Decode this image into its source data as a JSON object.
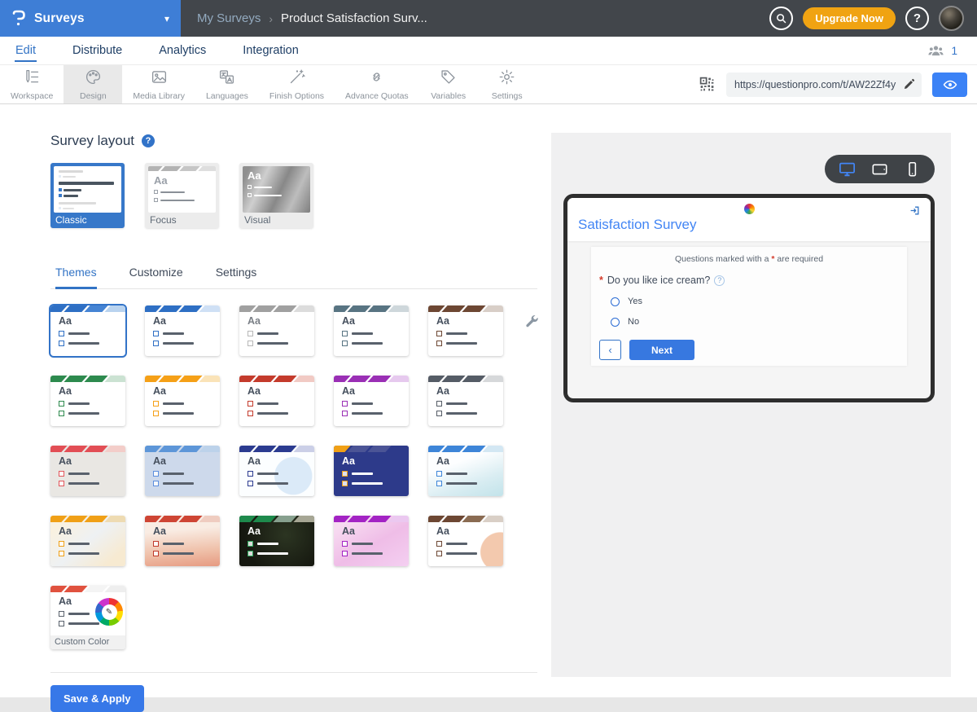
{
  "colors": {
    "accent": "#3273c8",
    "topbar_blue": "#3e7ed6",
    "topbar_dark": "#42464b",
    "upgrade_orange": "#f0a312",
    "preview_title_blue": "#4285f4"
  },
  "topbar": {
    "brand": "Surveys",
    "breadcrumb": {
      "parent": "My Surveys",
      "separator": "›",
      "current": "Product Satisfaction Surv..."
    },
    "upgrade_label": "Upgrade Now",
    "help_label": "?"
  },
  "nav": {
    "items": [
      "Edit",
      "Distribute",
      "Analytics",
      "Integration"
    ],
    "active": "Edit",
    "collaborators_count": "1"
  },
  "toolbar": {
    "items": [
      {
        "label": "Workspace",
        "icon": "workspace-icon"
      },
      {
        "label": "Design",
        "icon": "design-icon"
      },
      {
        "label": "Media Library",
        "icon": "media-library-icon"
      },
      {
        "label": "Languages",
        "icon": "languages-icon"
      },
      {
        "label": "Finish Options",
        "icon": "finish-options-icon"
      },
      {
        "label": "Advance Quotas",
        "icon": "advance-quotas-icon"
      },
      {
        "label": "Variables",
        "icon": "variables-icon"
      },
      {
        "label": "Settings",
        "icon": "settings-icon"
      }
    ],
    "active": "Design",
    "url": "https://questionpro.com/t/AW22Zf4y"
  },
  "survey_layout": {
    "title": "Survey layout",
    "options": [
      {
        "label": "Classic",
        "selected": true
      },
      {
        "label": "Focus",
        "selected": false
      },
      {
        "label": "Visual",
        "selected": false
      }
    ]
  },
  "theme_tabs": {
    "items": [
      "Themes",
      "Customize",
      "Settings"
    ],
    "active": "Themes"
  },
  "sample_text": "Aa",
  "themes": [
    {
      "name": "blue",
      "stripes": [
        "#2e6fc4",
        "#2e6fc4",
        "#4584d4",
        "#b9d3ef"
      ],
      "box": "#2e6fc4",
      "body": "#ffffff",
      "selected": true
    },
    {
      "name": "azure",
      "stripes": [
        "#2e6fc4",
        "#2e6fc4",
        "#2e6fc4",
        "#cfe0f5"
      ],
      "box": "#2e6fc4",
      "body": "#ffffff"
    },
    {
      "name": "gray",
      "stripes": [
        "#a0a0a0",
        "#a0a0a0",
        "#a0a0a0",
        "#dcdcdc"
      ],
      "box": "#b7b7b7",
      "body": "#ffffff",
      "text": "#7a7f86"
    },
    {
      "name": "slate",
      "stripes": [
        "#587482",
        "#587482",
        "#587482",
        "#ced7db"
      ],
      "box": "#587482",
      "body": "#ffffff"
    },
    {
      "name": "brown",
      "stripes": [
        "#6d4733",
        "#6d4733",
        "#6d4733",
        "#d8cec7"
      ],
      "box": "#6d4733",
      "body": "#ffffff"
    },
    {
      "name": "green",
      "stripes": [
        "#2d8a4e",
        "#2d8a4e",
        "#2d8a4e",
        "#cbe2d2"
      ],
      "box": "#2d8a4e",
      "body": "#ffffff"
    },
    {
      "name": "orange",
      "stripes": [
        "#f5a017",
        "#f5a017",
        "#f5a017",
        "#fae3b8"
      ],
      "box": "#f5a017",
      "body": "#ffffff"
    },
    {
      "name": "red",
      "stripes": [
        "#c43b2c",
        "#c43b2c",
        "#c43b2c",
        "#f1cac4"
      ],
      "box": "#c43b2c",
      "body": "#ffffff"
    },
    {
      "name": "purple",
      "stripes": [
        "#9a2fb5",
        "#9a2fb5",
        "#9a2fb5",
        "#e6c9ee"
      ],
      "box": "#9a2fb5",
      "body": "#ffffff"
    },
    {
      "name": "charcoal",
      "stripes": [
        "#555c66",
        "#555c66",
        "#555c66",
        "#d6d8da"
      ],
      "box": "#555c66",
      "body": "#ffffff"
    },
    {
      "name": "crimson-beige",
      "stripes": [
        "#e24e55",
        "#e24e55",
        "#e24e55",
        "#f3cdc9"
      ],
      "box": "#e2565c",
      "body": "#e9e7e3"
    },
    {
      "name": "powder-blue",
      "stripes": [
        "#5d96d8",
        "#5d96d8",
        "#5d96d8",
        "#bcd2ea"
      ],
      "box": "#5c8ede",
      "body": "#cdd9eb"
    },
    {
      "name": "navy-cloud",
      "stripes": [
        "#2b3b90",
        "#2b3b90",
        "#2b3b90",
        "#cbcfe7"
      ],
      "box": "#2b3b90",
      "body": "radial-gradient(circle at 72% 60%, #dbeaf8 30%, #fcfeff 31%)"
    },
    {
      "name": "navy-bold",
      "stripes": [
        "#f0a016",
        "#4b5496",
        "#4b5496",
        "#2d3a8a"
      ],
      "box": "#f0a016",
      "body": "#2d3a8a",
      "text": "#ffffff",
      "lines": "#ffffff"
    },
    {
      "name": "sky",
      "stripes": [
        "#3d85d8",
        "#3d85d8",
        "#3d85d8",
        "#d3e7f3"
      ],
      "box": "#3d85d8",
      "body": "linear-gradient(160deg, #fdfeff 35%, #d9edf2 70%, #c2e3ea 100%)"
    },
    {
      "name": "cream",
      "stripes": [
        "#f0a016",
        "#f0a016",
        "#f0a016",
        "#eedbb2"
      ],
      "box": "#f0a016",
      "body": "linear-gradient(140deg, #f9f1e0 15%, #eef1f3 50%, #f7ead1 85%)"
    },
    {
      "name": "peach",
      "stripes": [
        "#ce4534",
        "#ce4534",
        "#ce4534",
        "#efccc0"
      ],
      "box": "#c0392b",
      "body": "linear-gradient(175deg, #f9ece3 30%, #efc0a9 70%, #e69a81 100%)"
    },
    {
      "name": "forest-dark",
      "stripes": [
        "#1e8a4c",
        "#1e8a4c",
        "#87a08e",
        "#a6a694"
      ],
      "box": "#2fa55c",
      "body": "radial-gradient(circle at 62% 38%, #2c3522 0%, #15170f 75%)",
      "text": "#ffffff",
      "lines": "#ffffff"
    },
    {
      "name": "orchid",
      "stripes": [
        "#a323c4",
        "#a323c4",
        "#a323c4",
        "#ebc8f0"
      ],
      "box": "#a323c4",
      "body": "linear-gradient(150deg, #f7dbf1 15%, #efbde7 55%, #f4cff1 100%)"
    },
    {
      "name": "blush",
      "stripes": [
        "#6d4733",
        "#6d4733",
        "#8a6b52",
        "#d9cfc6"
      ],
      "box": "#6d4733",
      "body": "radial-gradient(circle at 96% 72%, #f3c9ae 24%, #ffffff 25%)"
    }
  ],
  "custom_theme": {
    "name": "custom",
    "stripes": [
      "#e0523f",
      "#e0523f",
      "#f4f4f4",
      "#eeeeee"
    ],
    "box": "#59616c",
    "body": "#ffffff",
    "label": "Custom Color"
  },
  "save_button": "Save & Apply",
  "preview": {
    "title": "Satisfaction Survey",
    "required_note": {
      "prefix": "Questions marked with a ",
      "star": "*",
      "suffix": " are required"
    },
    "question": {
      "star": "*",
      "text": "Do you like ice cream?",
      "help": "?"
    },
    "options": [
      "Yes",
      "No"
    ],
    "back_label": "‹",
    "next_label": "Next"
  }
}
